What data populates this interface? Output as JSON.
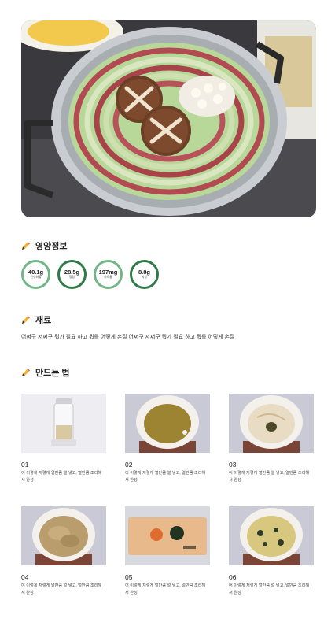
{
  "nutrition": {
    "title": "영양정보",
    "items": [
      {
        "value": "40.1g",
        "label": "탄수화물"
      },
      {
        "value": "28.5g",
        "label": "정량"
      },
      {
        "value": "197mg",
        "label": "나트륨"
      },
      {
        "value": "8.8g",
        "label": "지방"
      }
    ]
  },
  "ingredients": {
    "title": "재료",
    "text": "어쩌구 저쩌구 뭐가 필요 하고 뭐를 어떻게 손질 어쩌구 저쩌구 뭐가 필요 하고 뭐를 어떻게 손질"
  },
  "steps": {
    "title": "만드는 법",
    "items": [
      {
        "num": "01",
        "desc": "어 이렇게 저렇게 얼만큼 얼 넣고, 얼만큼 조리해서 완성"
      },
      {
        "num": "02",
        "desc": "어 이렇게 저렇게 얼만큼 얼 넣고, 얼만큼 조리해서 완성"
      },
      {
        "num": "03",
        "desc": "어 이렇게 저렇게 얼만큼 얼 넣고, 얼만큼 조리해서 완성"
      },
      {
        "num": "04",
        "desc": "어 이렇게 저렇게 얼만큼 얼 넣고, 얼만큼 조리해서 완성"
      },
      {
        "num": "05",
        "desc": "어 이렇게 저렇게 얼만큼 얼 넣고, 얼만큼 조리해서 완성"
      },
      {
        "num": "06",
        "desc": "어 이렇게 저렇게 얼만큼 얼 넣고, 얼만큼 조리해서 완성"
      }
    ]
  },
  "colors": {
    "ring_dark": "#2f7a48",
    "ring_light": "#72b586"
  }
}
